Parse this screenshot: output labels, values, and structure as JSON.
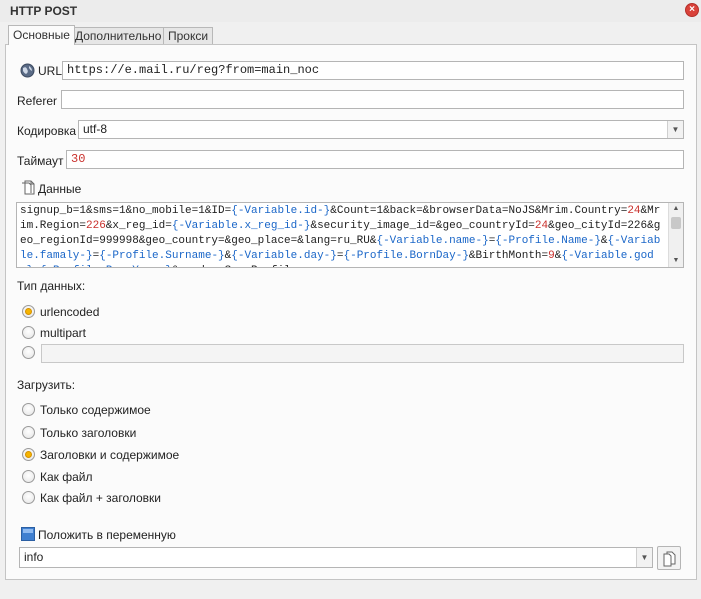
{
  "window": {
    "title": "HTTP POST",
    "close_icon": "close-icon"
  },
  "tabs": [
    {
      "label": "Основные",
      "active": true
    },
    {
      "label": "Дополнительно",
      "active": false
    },
    {
      "label": "Прокси",
      "active": false
    }
  ],
  "url": {
    "label": "URL",
    "value": "https://e.mail.ru/reg?from=main_noc",
    "icon": "globe-icon"
  },
  "referer": {
    "label": "Referer",
    "value": ""
  },
  "encoding": {
    "label": "Кодировка",
    "value": "utf-8"
  },
  "timeout": {
    "label": "Таймаут",
    "value": "30"
  },
  "data": {
    "label": "Данные",
    "icon": "document-icon",
    "segments": [
      {
        "t": "signup_b=1&sms=1&no_mobile=1&ID=",
        "k": "plain"
      },
      {
        "t": "{-Variable.id-}",
        "k": "var"
      },
      {
        "t": "&Count=1&back=&browserData=NoJS&Mrim.Country=",
        "k": "plain"
      },
      {
        "t": "24",
        "k": "hl"
      },
      {
        "t": "&Mrim.Region=",
        "k": "plain"
      },
      {
        "t": "226",
        "k": "hl"
      },
      {
        "t": "&x_reg_id=",
        "k": "plain"
      },
      {
        "t": "{-Variable.x_reg_id-}",
        "k": "var"
      },
      {
        "t": "&security_image_id=&geo_countryId=",
        "k": "plain"
      },
      {
        "t": "24",
        "k": "hl"
      },
      {
        "t": "&geo_cityId=226&geo_regionId=999998&geo_country=&geo_place=&lang=ru_RU&",
        "k": "plain"
      },
      {
        "t": "{-Variable.name-}",
        "k": "var"
      },
      {
        "t": "=",
        "k": "plain"
      },
      {
        "t": "{-Profile.Name-}",
        "k": "var"
      },
      {
        "t": "&",
        "k": "plain"
      },
      {
        "t": "{-Variable.famaly-}",
        "k": "var"
      },
      {
        "t": "=",
        "k": "plain"
      },
      {
        "t": "{-Profile.Surname-}",
        "k": "var"
      },
      {
        "t": "&",
        "k": "plain"
      },
      {
        "t": "{-Variable.day-}",
        "k": "var"
      },
      {
        "t": "=",
        "k": "plain"
      },
      {
        "t": "{-Profile.BornDay-}",
        "k": "var"
      },
      {
        "t": "&BirthMonth=",
        "k": "plain"
      },
      {
        "t": "9",
        "k": "hl"
      },
      {
        "t": "&",
        "k": "plain"
      },
      {
        "t": "{-Variable.god-}",
        "k": "var"
      },
      {
        "t": "=",
        "k": "plain"
      },
      {
        "t": "{-Profile.BornYear-}",
        "k": "var"
      },
      {
        "t": "&gender=Sex=Profile",
        "k": "plain"
      }
    ]
  },
  "data_type": {
    "label": "Тип данных:",
    "options": [
      {
        "label": "urlencoded",
        "checked": true
      },
      {
        "label": "multipart",
        "checked": false
      }
    ],
    "custom_value": ""
  },
  "load": {
    "label": "Загрузить:",
    "options": [
      {
        "label": "Только содержимое",
        "checked": false
      },
      {
        "label": "Только заголовки",
        "checked": false
      },
      {
        "label": "Заголовки и содержимое",
        "checked": true
      },
      {
        "label": "Как файл",
        "checked": false
      },
      {
        "label": "Как файл + заголовки",
        "checked": false
      }
    ]
  },
  "save_to_var": {
    "label": "Положить в переменную",
    "value": "info",
    "icon": "variable-icon",
    "copy_icon": "copy-icon"
  }
}
